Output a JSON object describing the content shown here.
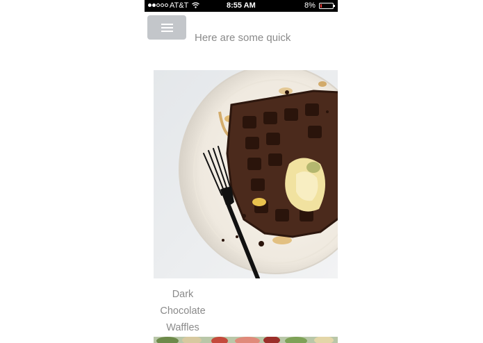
{
  "status_bar": {
    "carrier": "AT&T",
    "time": "8:55 AM",
    "battery": "8%"
  },
  "header": {
    "menu_icon": "hamburger-menu-icon",
    "intro_text": "Here are some quick"
  },
  "recipes": [
    {
      "title_lines": [
        "Dark",
        "Chocolate",
        "Waffles"
      ]
    }
  ],
  "colors": {
    "menu_button": "#c3c6ca",
    "text_gray": "#8a8a8a",
    "status_bar": "#000000",
    "battery_low": "#e53935"
  }
}
